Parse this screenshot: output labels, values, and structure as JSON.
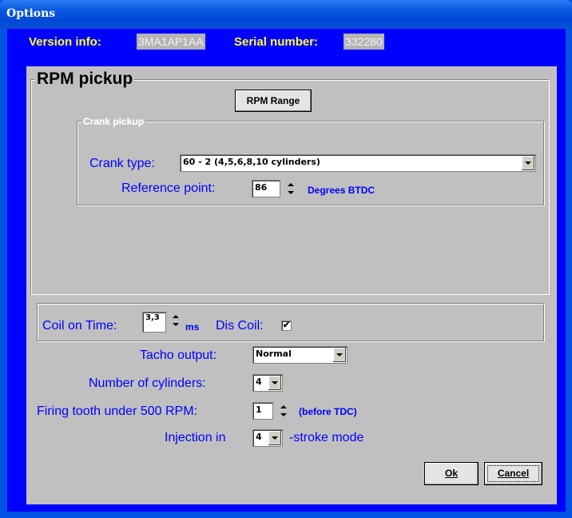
{
  "window": {
    "title": "Options"
  },
  "header": {
    "version_label": "Version info:",
    "version_value": "3MA1AP1AA",
    "serial_label": "Serial number:",
    "serial_value": "332280"
  },
  "rpm_pickup": {
    "title": "RPM pickup",
    "rpm_range_button": "RPM Range",
    "crank_group_title": "Crank pickup",
    "crank_type_label": "Crank type:",
    "crank_type_value": "60 - 2  (4,5,6,8,10 cylinders)",
    "reference_label": "Reference point:",
    "reference_value": "86",
    "reference_unit": "Degrees BTDC"
  },
  "coil": {
    "coil_on_label": "Coil on Time:",
    "coil_on_value": "3,3",
    "coil_on_unit": "ms",
    "dis_coil_label": "Dis Coil:",
    "dis_coil_checked": "✔"
  },
  "settings": {
    "tacho_label": "Tacho output:",
    "tacho_value": "Normal",
    "cylinders_label": "Number of cylinders:",
    "cylinders_value": "4",
    "firing_label": "Firing tooth under 500 RPM:",
    "firing_value": "1",
    "firing_unit": "(before TDC)",
    "injection_label": "Injection in",
    "injection_value": "4",
    "injection_suffix": "-stroke mode"
  },
  "buttons": {
    "ok": "Ok",
    "cancel": "Cancel"
  },
  "colors": {
    "title_blue": "#0054e3",
    "client_blue": "#0000fe",
    "panel_gray": "#c0c0c0",
    "header_yellow": "#ffff30"
  }
}
